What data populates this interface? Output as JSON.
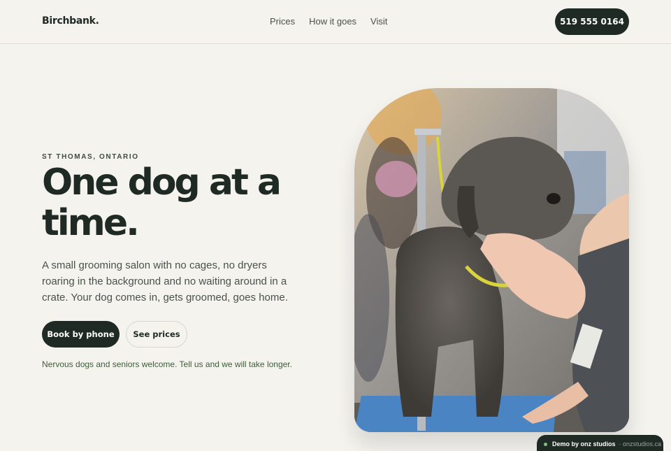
{
  "brand": {
    "name": "Birchbank."
  },
  "nav": {
    "items": [
      "Prices",
      "How it goes",
      "Visit"
    ]
  },
  "header": {
    "phone": "519 555 0164"
  },
  "hero": {
    "eyebrow": "ST THOMAS, ONTARIO",
    "headline": "One dog at a time.",
    "body": "A small grooming salon with no cages, no dryers roaring in the background and no waiting around in a crate. Your dog comes in, gets groomed, goes home.",
    "primary_button": "Book by phone",
    "secondary_button": "See prices",
    "note": "Nervous dogs and seniors welcome. Tell us and we will take longer."
  },
  "badge": {
    "label": "Demo by onz studios",
    "site": "· onzstudios.ca"
  },
  "colors": {
    "accent": "#1f2a24",
    "background": "#f4f3ee",
    "note": "#3d5c3a"
  }
}
